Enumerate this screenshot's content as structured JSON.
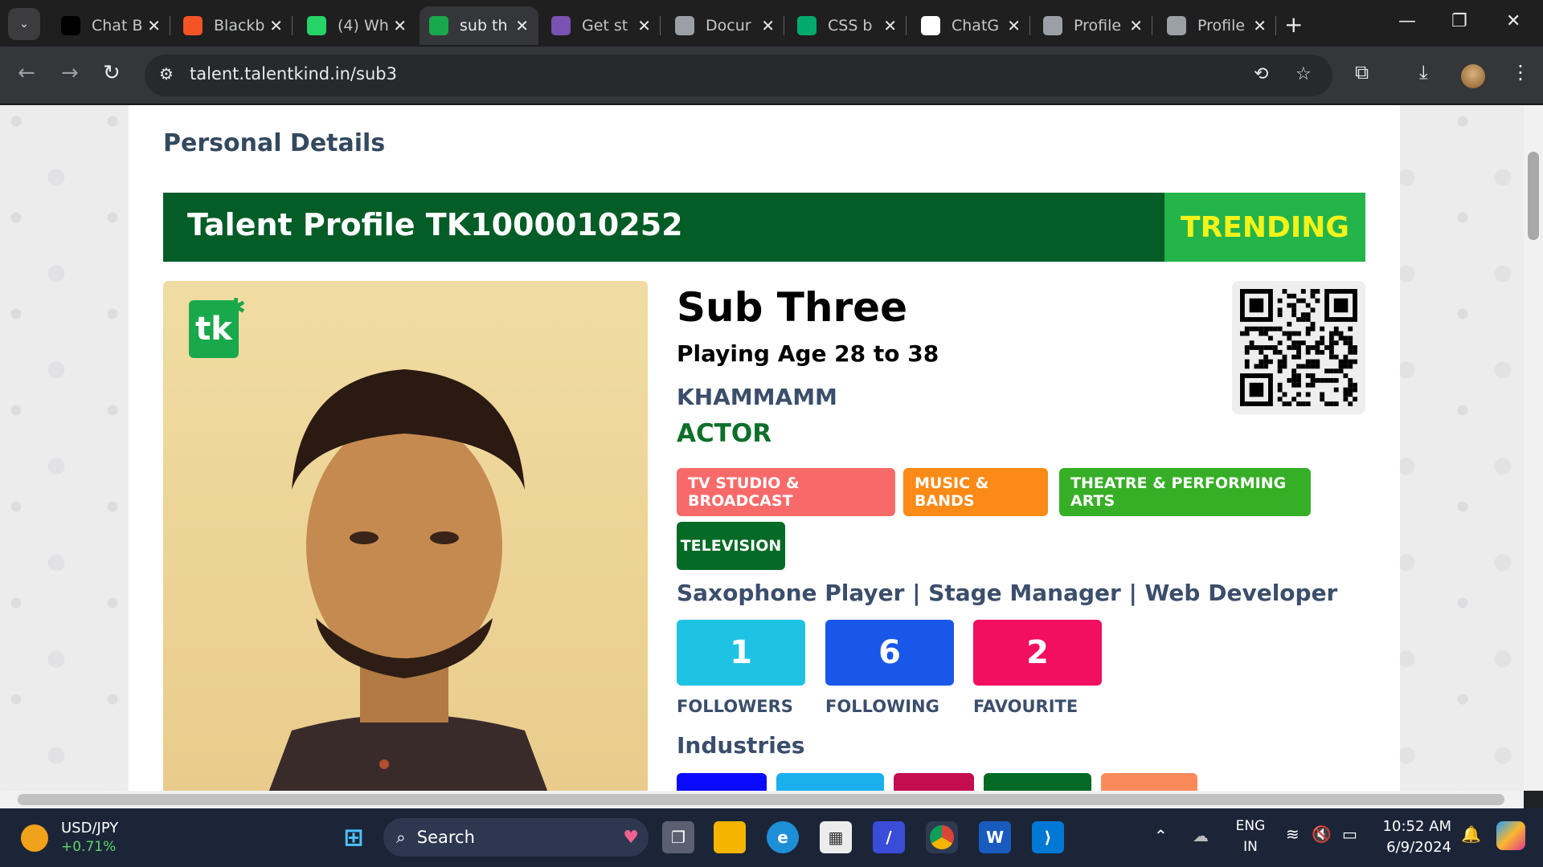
{
  "tabs": [
    {
      "label": "Chat B",
      "icon": "dots-icon",
      "color": "#000000"
    },
    {
      "label": "Blackb",
      "icon": "microsoft-icon",
      "color": "#f35325"
    },
    {
      "label": "(4) Wh",
      "icon": "whatsapp-icon",
      "color": "#25d366"
    },
    {
      "label": "sub th",
      "icon": "tk-icon",
      "color": "#19a84b"
    },
    {
      "label": "Get st",
      "icon": "bootstrap-icon",
      "color": "#7952b3"
    },
    {
      "label": "Docur",
      "icon": "globe-icon",
      "color": "#9aa0a6"
    },
    {
      "label": "CSS b",
      "icon": "w3-icon",
      "color": "#04aa6d"
    },
    {
      "label": "ChatG",
      "icon": "chatgpt-icon",
      "color": "#ffffff"
    },
    {
      "label": "Profile",
      "icon": "globe-icon",
      "color": "#9aa0a6"
    },
    {
      "label": "Profile",
      "icon": "globe-icon",
      "color": "#9aa0a6"
    }
  ],
  "url": "talent.talentkind.in/sub3",
  "page": {
    "section_title": "Personal Details",
    "banner_title": "Talent Profile TK1000010252",
    "banner_badge": "TRENDING",
    "logo_text": "tk",
    "name": "Sub Three",
    "playing_age": "Playing Age 28 to 38",
    "city": "KHAMMAMM",
    "role": "ACTOR",
    "categories": [
      {
        "label": "TV STUDIO & BROADCAST",
        "color": "#f86a6a"
      },
      {
        "label": "MUSIC & BANDS",
        "color": "#fb8a17"
      },
      {
        "label": "THEATRE & PERFORMING ARTS",
        "color": "#36ae26"
      },
      {
        "label": "TELEVISION",
        "color": "#046a26"
      }
    ],
    "skills": "Saxophone Player | Stage Manager | Web Developer",
    "stats": [
      {
        "value": "1",
        "label": "FOLLOWERS",
        "color": "#1ec3e4"
      },
      {
        "value": "6",
        "label": "FOLLOWING",
        "color": "#1957e8"
      },
      {
        "value": "2",
        "label": "FAVOURITE",
        "color": "#f20f60"
      }
    ],
    "industries_title": "Industries",
    "industry_colors": [
      "#0a0aff",
      "#1ab0ee",
      "#c40d4f",
      "#046a26",
      "#fb8a5a"
    ]
  },
  "taskbar": {
    "ticker_symbol": "USD/JPY",
    "ticker_change": "+0.71%",
    "search": "Search",
    "lang_top": "ENG",
    "lang_bottom": "IN",
    "time": "10:52 AM",
    "date": "6/9/2024"
  }
}
